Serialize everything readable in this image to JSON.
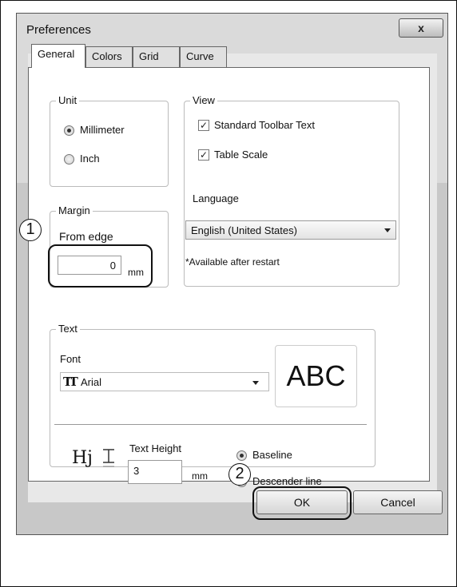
{
  "window": {
    "title": "Preferences",
    "close_glyph": "x"
  },
  "tabs": [
    {
      "label": "General",
      "active": true
    },
    {
      "label": "Colors",
      "active": false
    },
    {
      "label": "Grid",
      "active": false
    },
    {
      "label": "Curve",
      "active": false
    }
  ],
  "unit": {
    "label": "Unit",
    "options": [
      "Millimeter",
      "Inch"
    ],
    "selected": "Millimeter"
  },
  "view": {
    "label": "View",
    "checkboxes": [
      {
        "label": "Standard Toolbar Text",
        "checked": true
      },
      {
        "label": "Table Scale",
        "checked": true
      }
    ]
  },
  "language": {
    "label": "Language",
    "value": "English (United States)",
    "note": "*Available after restart"
  },
  "margin": {
    "label": "Margin",
    "from_edge_label": "From edge",
    "value": "0",
    "unit": "mm"
  },
  "text": {
    "label": "Text",
    "font_label": "Font",
    "font_value": "Arial",
    "font_icon": "truetype-font-icon",
    "preview": "ABC",
    "height_icon_text": "Hj",
    "height_icon": "text-height-icon",
    "height_label": "Text Height",
    "height_value": "3",
    "height_unit": "mm",
    "alignment_options": [
      "Baseline",
      "Descender line"
    ],
    "alignment_selected": "Baseline"
  },
  "buttons": {
    "ok": "OK",
    "cancel": "Cancel"
  },
  "callouts": [
    "1",
    "2"
  ],
  "colors": {
    "window_frame": "#c8c8c8",
    "tab_body": "#ffffff",
    "border": "#666666"
  }
}
